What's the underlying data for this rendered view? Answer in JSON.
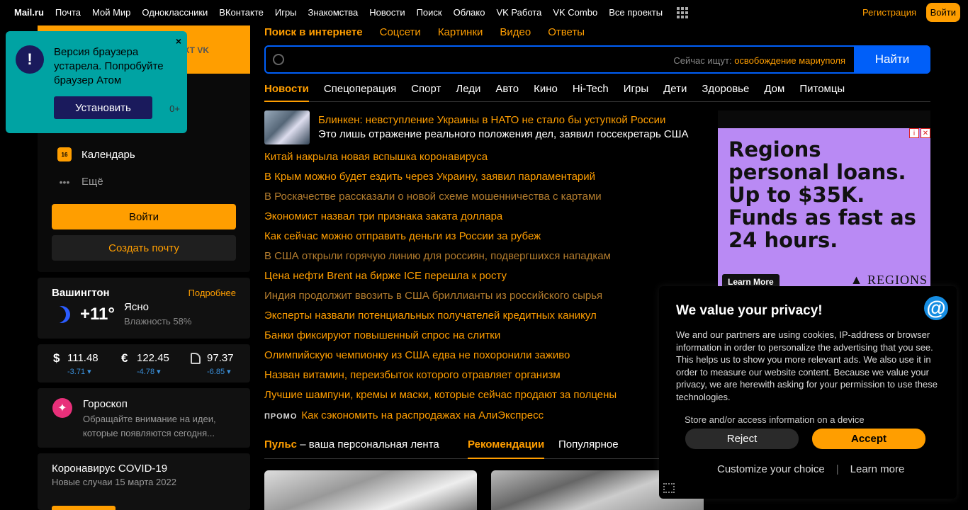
{
  "topnav": {
    "brand": "Mail.ru",
    "items": [
      "Почта",
      "Мой Мир",
      "Одноклассники",
      "ВКонтакте",
      "Игры",
      "Знакомства",
      "Новости",
      "Поиск",
      "Облако",
      "VK Работа",
      "VK Combo",
      "Все проекты"
    ],
    "register": "Регистрация",
    "login": "Войти"
  },
  "mail_card": {
    "vk_partial": "КТ VK",
    "menu": [
      {
        "label": "Календарь",
        "icon": "calendar-icon",
        "icon_text": "16"
      },
      {
        "label": "Ещё",
        "icon": "more-dots-icon"
      }
    ],
    "login_button": "Войти",
    "create_button": "Создать почту"
  },
  "browser_notice": {
    "message": "Версия браузера устарела. Попробуйте браузер Атом",
    "install": "Установить",
    "age": "0+",
    "close": "×"
  },
  "weather": {
    "city": "Вашингтон",
    "more": "Подробнее",
    "temp": "+11°",
    "condition": "Ясно",
    "humidity": "Влажность 58%"
  },
  "currency": [
    {
      "symbol": "$",
      "value": "111.48",
      "change": "-3.71 ▾"
    },
    {
      "symbol": "€",
      "value": "122.45",
      "change": "-4.78 ▾"
    },
    {
      "symbol": "oil-icon",
      "value": "97.37",
      "change": "-6.85 ▾"
    }
  ],
  "horoscope": {
    "title": "Гороскоп",
    "text": "Обращайте внимание на идеи, которые появляются сегодня..."
  },
  "covid": {
    "title": "Коронавирус COVID-19",
    "subtitle": "Новые случаи 15 марта 2022"
  },
  "search": {
    "tabs": [
      "Поиск в интернете",
      "Соцсети",
      "Картинки",
      "Видео",
      "Ответы"
    ],
    "hint_label": "Сейчас ищут:",
    "hint_value": "освобождение мариуполя",
    "find": "Найти"
  },
  "news_tabs": [
    "Новости",
    "Спецоперация",
    "Спорт",
    "Леди",
    "Авто",
    "Кино",
    "Hi-Tech",
    "Игры",
    "Дети",
    "Здоровье",
    "Дом",
    "Питомцы"
  ],
  "lead": {
    "title": "Блинкен: невступление Украины в НАТО не стало бы уступкой России",
    "subtitle": "Это лишь отражение реального положения дел, заявил госсекретарь США"
  },
  "news": [
    {
      "text": "Китай накрыла новая вспышка коронавируса",
      "visited": false
    },
    {
      "text": "В Крым можно будет ездить через Украину, заявил парламентарий",
      "visited": false
    },
    {
      "text": "В Роскачестве рассказали о новой схеме мошенничества с картами",
      "visited": true
    },
    {
      "text": "Экономист назвал три признака заката доллара",
      "visited": false
    },
    {
      "text": "Как сейчас можно отправить деньги из России за рубеж",
      "visited": false
    },
    {
      "text": "В США открыли горячую линию для россиян, подвергшихся нападкам",
      "visited": true
    },
    {
      "text": "Цена нефти Brent на бирже ICE перешла к росту",
      "visited": false
    },
    {
      "text": "Индия продолжит ввозить в США бриллианты из российского сырья",
      "visited": true
    },
    {
      "text": "Эксперты назвали потенциальных получателей кредитных каникул",
      "visited": false
    },
    {
      "text": "Банки фиксируют повышенный спрос на слитки",
      "visited": false
    },
    {
      "text": "Олимпийскую чемпионку из США едва не похоронили заживо",
      "visited": false
    },
    {
      "text": "Назван витамин, переизбыток которого отравляет организм",
      "visited": false
    },
    {
      "text": "Лучшие шампуни, кремы и маски, которые сейчас продают за полцены",
      "visited": false
    }
  ],
  "promo": {
    "tag": "ПРОМО",
    "text": "Как сэкономить на распродажах на АлиЭкспресс"
  },
  "pulse": {
    "brand": "Пульс",
    "tagline": "– ваша персональная лента",
    "tab_recommend": "Рекомендации",
    "tab_popular": "Популярное"
  },
  "ad": {
    "headline": "Regions personal loans. Up to $35K. Funds as fast as 24 hours.",
    "cta": "Learn More",
    "brand": "REGIONS",
    "bg": "#b98af4"
  },
  "privacy": {
    "title": "We value your privacy!",
    "body": "We and our partners are using cookies, IP-address or browser information in order to personalize the advertising that you see. This helps us to show you more relevant ads. We also use it in order to measure our website content. Because we value your privacy, we are herewith asking for your permission to use these technologies.",
    "store": "Store and/or access information on a device",
    "reject": "Reject",
    "accept": "Accept",
    "customize": "Customize your choice",
    "separator": "|",
    "learn": "Learn more"
  },
  "colors": {
    "accent": "#ff9e00",
    "blue": "#005ff9",
    "notice": "#00a3a3"
  }
}
